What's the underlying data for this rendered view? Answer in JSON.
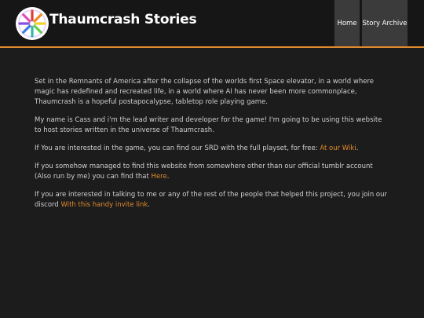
{
  "header": {
    "site_title": "Thaumcrash Stories",
    "logo_icon": "color-wheel-logo-icon",
    "nav": [
      {
        "label": "Home"
      },
      {
        "label": "Story Archive"
      }
    ]
  },
  "content": {
    "p1": "Set in the Remnants of America after the collapse of the worlds first Space elevator, in a world where magic has redefined and recreated life, in a world where AI has never been more commonplace, Thaumcrash is a hopeful postapocalypse, tabletop role playing game.",
    "p2": "My name is Cass and i'm the lead writer and developer for the game! I'm going to be using this website to host stories written in the universe of Thaumcrash.",
    "p3_text": "If You are interested in the game, you can find our SRD with the full playset, for free: ",
    "p3_link": "At our Wiki",
    "p3_end": ".",
    "p4_text": "If you somehow managed to find this website from somewhere other than our official tumblr account (Also run by me) you can find that ",
    "p4_link": "Here",
    "p4_end": ".",
    "p5_text": "If you are interested in talking to me or any of the rest of the people that helped this project, you join our discord ",
    "p5_link": "With this handy invite link",
    "p5_end": "."
  },
  "colors": {
    "accent": "#e08a2c",
    "background": "#1c1c1c",
    "header_bg": "#161616",
    "nav_bg": "#3b3b3b",
    "text": "#cfcfcf"
  }
}
